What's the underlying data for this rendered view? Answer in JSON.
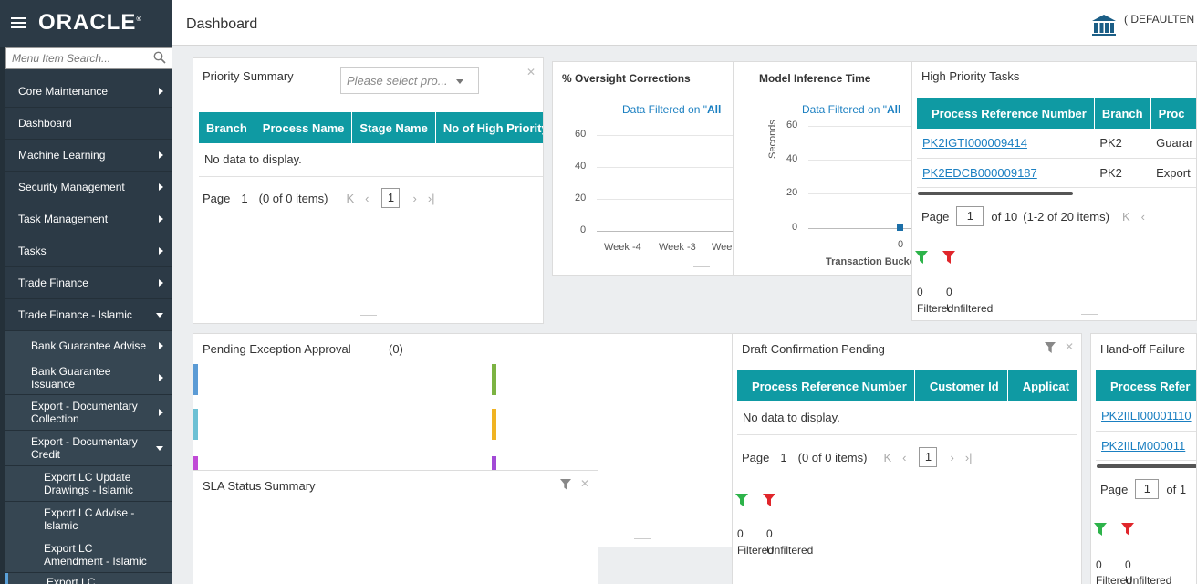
{
  "app": {
    "logo": "ORACLE",
    "page_title": "Dashboard",
    "user_label": "( DEFAULTEN"
  },
  "sidebar": {
    "search_placeholder": "Menu Item Search...",
    "items": [
      {
        "label": "Core Maintenance"
      },
      {
        "label": "Dashboard"
      },
      {
        "label": "Machine Learning"
      },
      {
        "label": "Security Management"
      },
      {
        "label": "Task Management"
      },
      {
        "label": "Tasks"
      },
      {
        "label": "Trade Finance"
      },
      {
        "label": "Trade Finance - Islamic"
      },
      {
        "label": "Bank Guarantee Advise"
      },
      {
        "label": "Bank Guarantee Issuance"
      },
      {
        "label": "Export - Documentary Collection"
      },
      {
        "label": "Export - Documentary Credit"
      },
      {
        "label": "Export LC Update Drawings - Islamic"
      },
      {
        "label": "Export LC Advise - Islamic"
      },
      {
        "label": "Export LC Amendment - Islamic"
      },
      {
        "label": "Export LC Amendment"
      }
    ]
  },
  "priority_summary": {
    "title": "Priority Summary",
    "select_placeholder": "Please select pro...",
    "columns": [
      "Branch",
      "Process Name",
      "Stage Name",
      "No of High Priority I"
    ],
    "empty": "No data to display.",
    "page_label": "Page",
    "page_num": "1",
    "items_label": "(0 of 0 items)",
    "page_box": "1"
  },
  "oversight": {
    "title": "% Oversight Corrections",
    "filter_note_prefix": "Data Filtered on \"",
    "filter_note_value": "All",
    "yticks": [
      "60",
      "40",
      "20",
      "0"
    ],
    "xticks": [
      "Week -4",
      "Week -3",
      "Wee"
    ]
  },
  "model_inference": {
    "title": "Model Inference Time",
    "filter_note_prefix": "Data Filtered on \"",
    "filter_note_value": "All",
    "ylabel": "Seconds",
    "yticks": [
      "60",
      "40",
      "20",
      "0"
    ],
    "xtick": "0",
    "xlabel": "Transaction Bucket"
  },
  "high_priority": {
    "title": "High Priority Tasks",
    "columns": [
      "Process Reference Number",
      "Branch",
      "Proc"
    ],
    "rows": [
      [
        "PK2IGTI000009414",
        "PK2",
        "Guarar"
      ],
      [
        "PK2EDCB000009187",
        "PK2",
        "Export"
      ]
    ],
    "page_label": "Page",
    "page_input": "1",
    "page_of": "of 10",
    "items_label": "(1-2 of 20 items)",
    "filtered_count": "0",
    "unfiltered_count": "0",
    "filtered_label": "Filtered",
    "unfiltered_label": "Unfiltered"
  },
  "pending_exception": {
    "title": "Pending Exception Approval",
    "count": "(0)"
  },
  "draft_confirmation": {
    "title": "Draft Confirmation Pending",
    "columns": [
      "Process Reference Number",
      "Customer Id",
      "Applicat"
    ],
    "empty": "No data to display.",
    "page_label": "Page",
    "page_num": "1",
    "items_label": "(0 of 0 items)",
    "page_box": "1",
    "filtered_count": "0",
    "unfiltered_count": "0",
    "filtered_label": "Filtered",
    "unfiltered_label": "Unfiltered"
  },
  "handoff": {
    "title": "Hand-off Failure",
    "columns": [
      "Process Refer"
    ],
    "rows": [
      [
        "PK2IILI00001110"
      ],
      [
        "PK2IILM000011"
      ]
    ],
    "page_label": "Page",
    "page_input": "1",
    "page_of": "of 1",
    "filtered_count": "0",
    "unfiltered_count": "0",
    "filtered_label": "Filtered",
    "unfiltered_label": "Unfiltered"
  },
  "sla": {
    "title": "SLA Status Summary"
  },
  "colors": {
    "teal": "#0f9aa3",
    "sidebar": "#2c3a46",
    "link": "#1a7fc1",
    "green_filter": "#2db34a",
    "red_filter": "#e0262b"
  }
}
